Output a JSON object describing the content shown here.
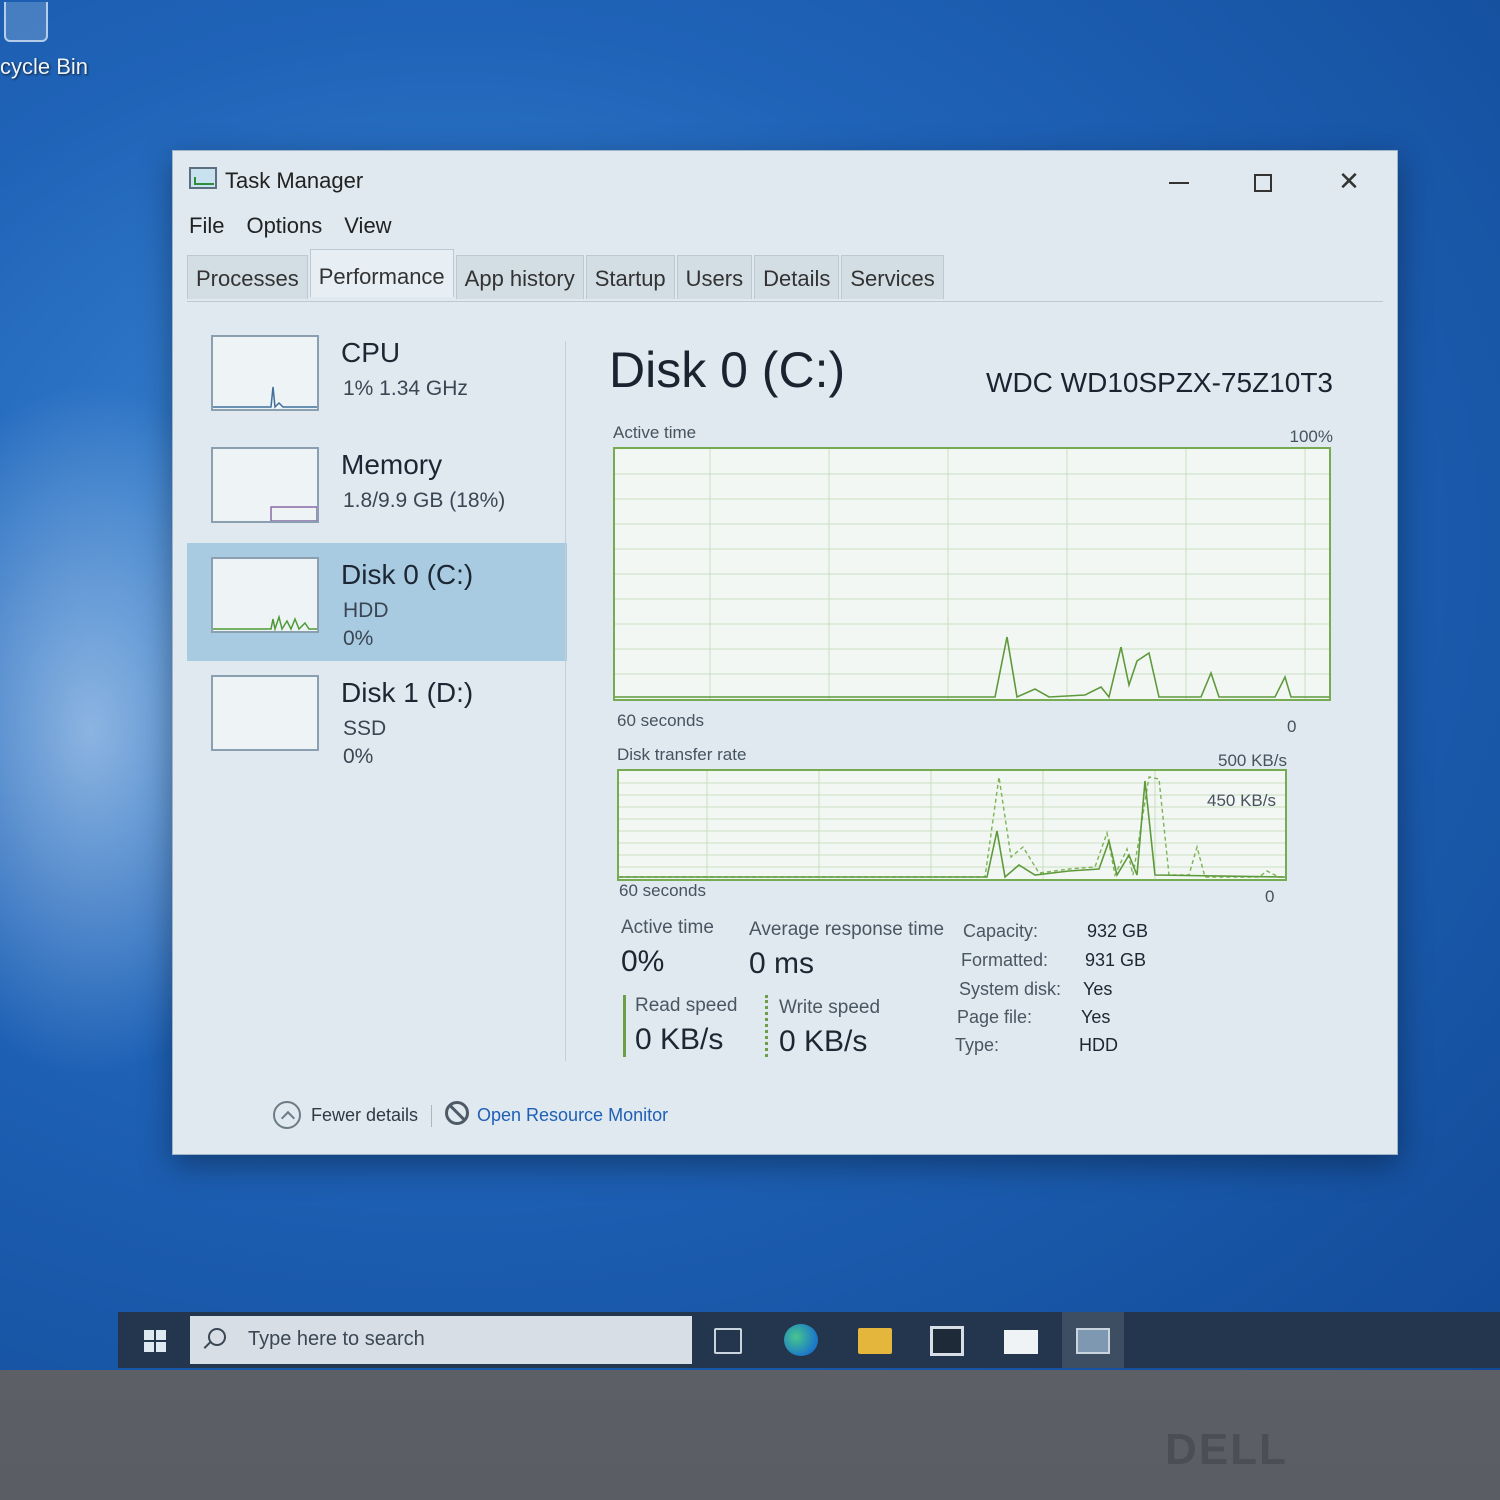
{
  "desktop": {
    "recycle_bin_label": "cycle Bin",
    "brand": "DELL"
  },
  "window": {
    "title": "Task Manager",
    "menu": [
      "File",
      "Options",
      "View"
    ],
    "tabs": [
      "Processes",
      "Performance",
      "App history",
      "Startup",
      "Users",
      "Details",
      "Services"
    ],
    "active_tab": "Performance"
  },
  "sidebar": {
    "items": [
      {
        "name": "CPU",
        "line1": "1%  1.34 GHz",
        "line2": ""
      },
      {
        "name": "Memory",
        "line1": "1.8/9.9 GB (18%)",
        "line2": ""
      },
      {
        "name": "Disk 0 (C:)",
        "line1": "HDD",
        "line2": "0%"
      },
      {
        "name": "Disk 1 (D:)",
        "line1": "SSD",
        "line2": "0%"
      }
    ],
    "selected_index": 2
  },
  "detail": {
    "title": "Disk 0 (C:)",
    "model": "WDC WD10SPZX-75Z10T3",
    "active_graph": {
      "label": "Active time",
      "max_label": "100%",
      "time_label": "60 seconds",
      "min_label": "0"
    },
    "transfer_graph": {
      "label": "Disk transfer rate",
      "max_label": "500 KB/s",
      "mid_label": "450 KB/s",
      "time_label": "60 seconds",
      "min_label": "0"
    },
    "stats": {
      "active_time_label": "Active time",
      "active_time_value": "0%",
      "avg_response_label": "Average response time",
      "avg_response_value": "0 ms",
      "read_speed_label": "Read speed",
      "read_speed_value": "0 KB/s",
      "write_speed_label": "Write speed",
      "write_speed_value": "0 KB/s"
    },
    "properties": [
      {
        "key": "Capacity:",
        "value": "932 GB"
      },
      {
        "key": "Formatted:",
        "value": "931 GB"
      },
      {
        "key": "System disk:",
        "value": "Yes"
      },
      {
        "key": "Page file:",
        "value": "Yes"
      },
      {
        "key": "Type:",
        "value": "HDD"
      }
    ]
  },
  "footer": {
    "fewer_details": "Fewer details",
    "open_resource_monitor": "Open Resource Monitor"
  },
  "taskbar": {
    "search_placeholder": "Type here to search",
    "icons": [
      "task-view-icon",
      "edge-icon",
      "file-explorer-icon",
      "store-icon",
      "mail-icon",
      "task-manager-icon"
    ]
  },
  "colors": {
    "graph_line": "#76ab52",
    "selection": "#a9cbe2",
    "link": "#1f5fb6"
  }
}
